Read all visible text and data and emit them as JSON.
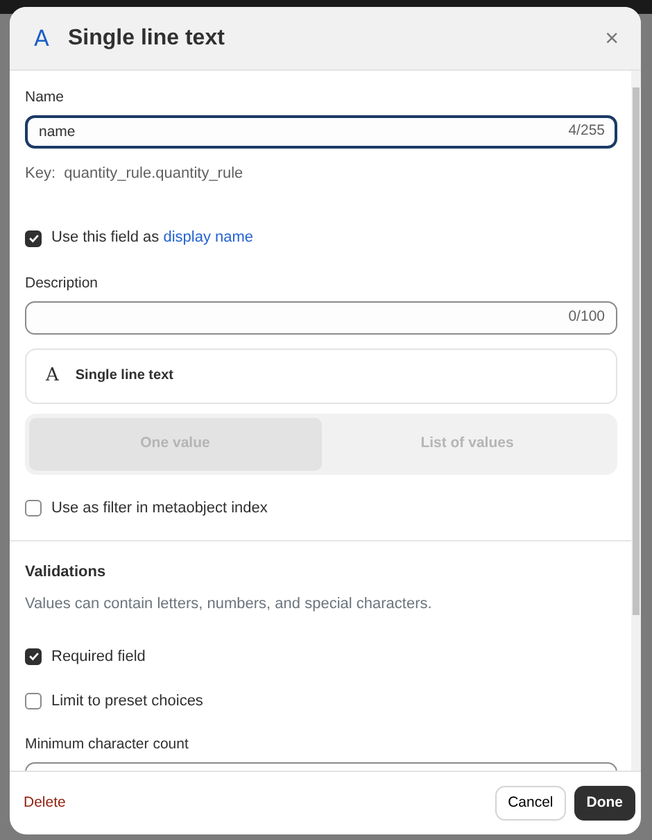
{
  "dialog": {
    "icon_glyph": "A",
    "title": "Single line text",
    "close_label": "×"
  },
  "name_field": {
    "label": "Name",
    "value": "name",
    "counter": "4/255",
    "focused": true
  },
  "key": {
    "label": "Key:",
    "value": "quantity_rule.quantity_rule"
  },
  "display_name_checkbox": {
    "label": "Use this field as ",
    "link": "display name",
    "checked": true
  },
  "description_field": {
    "label": "Description",
    "counter": "0/100",
    "focused": false
  },
  "type_card": {
    "label": "Single line text",
    "icon_glyph": "A"
  },
  "value_options": [
    {
      "label": "One value",
      "selected": true,
      "disabled": true
    },
    {
      "label": "List of values",
      "selected": false,
      "disabled": true
    }
  ],
  "filter_checkbox": {
    "label": "Use as filter in metaobject index",
    "checked": false
  },
  "validations": {
    "title": "Validations",
    "description": "Values can contain letters, numbers, and special characters.",
    "options": [
      {
        "label": "Required field",
        "checked": true
      },
      {
        "label": "Limit to preset choices",
        "checked": false
      }
    ],
    "min_field": {
      "label": "Minimum character count",
      "focused": false
    }
  },
  "footer": {
    "delete": "Delete",
    "cancel": "Cancel",
    "done": "Done"
  }
}
